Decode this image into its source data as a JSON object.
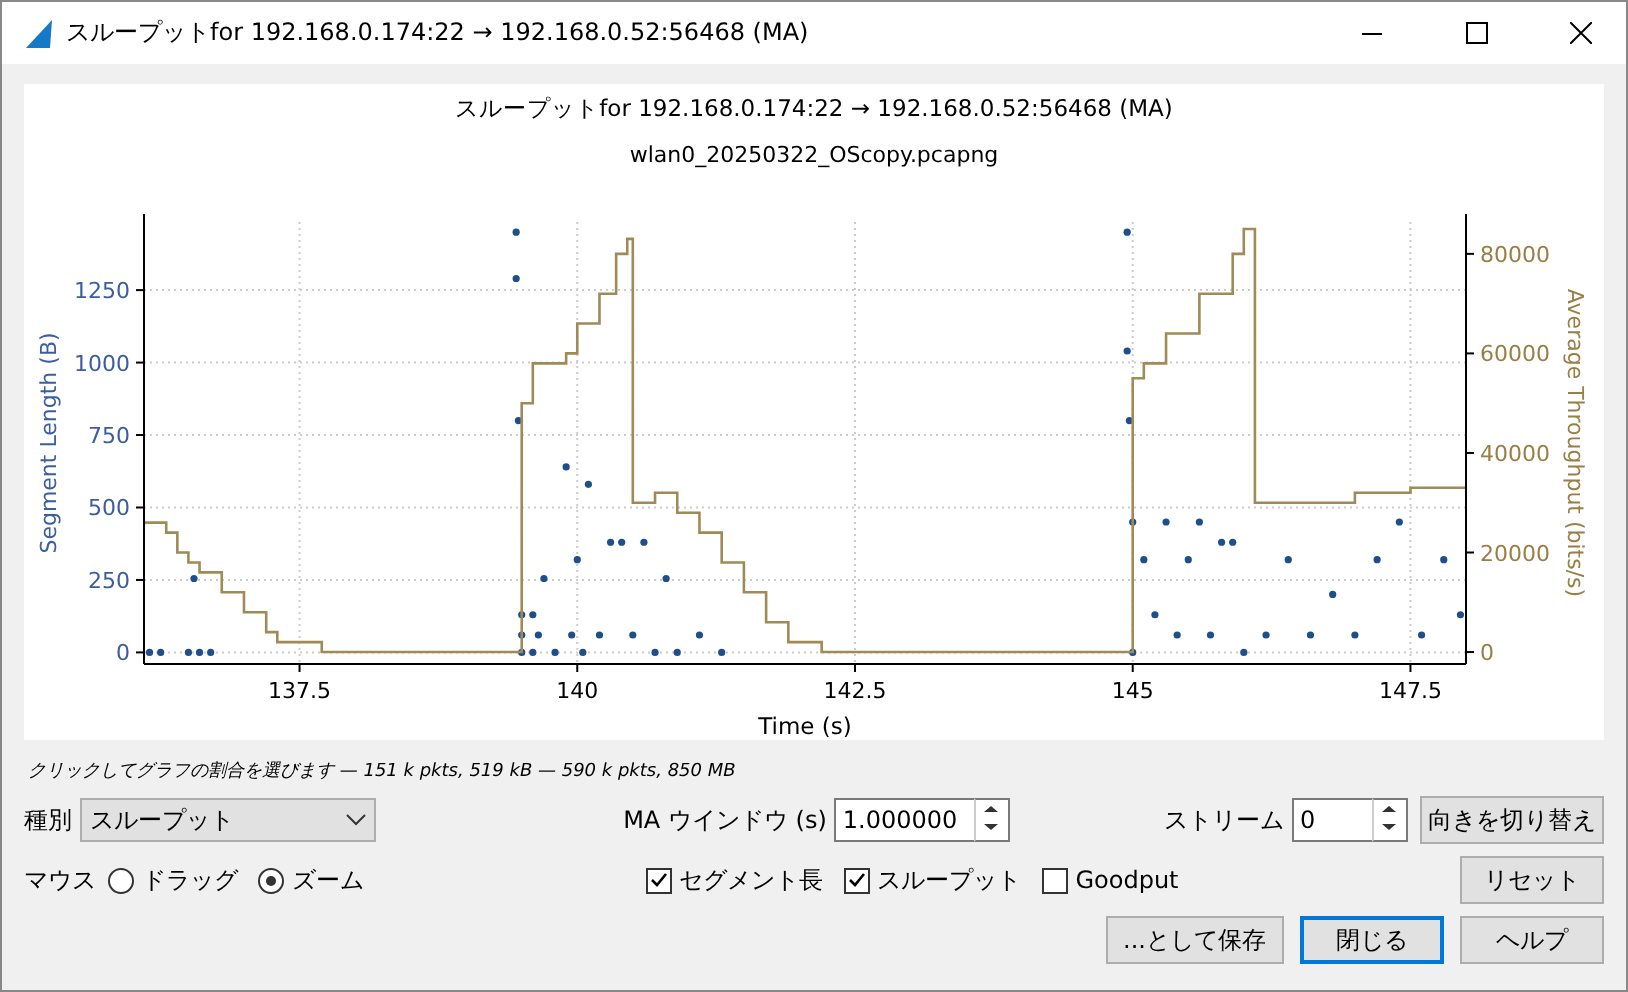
{
  "window": {
    "title": "スループットfor 192.168.0.174:22 → 192.168.0.52:56468 (MA)"
  },
  "chart": {
    "title": "スループットfor 192.168.0.174:22 → 192.168.0.52:56468 (MA)",
    "subtitle": "wlan0_20250322_OScopy.pcapng",
    "chart_data": {
      "type": "line",
      "xlabel": "Time (s)",
      "ylabel": "Segment Length (B)",
      "y2label": "Average Throughput (bits/s)",
      "grid": true,
      "xlim": [
        136.1,
        148
      ],
      "ylim": [
        -40,
        1485
      ],
      "y2lim": [
        -2400,
        86400
      ],
      "xticks": [
        137.5,
        140,
        142.5,
        145,
        147.5
      ],
      "yticks": [
        0,
        250,
        500,
        750,
        1000,
        1250
      ],
      "y2ticks": [
        0,
        20000,
        40000,
        60000,
        80000
      ],
      "series": [
        {
          "type": "scatter",
          "color": "#1f4e8c",
          "x": [
            136.15,
            136.25,
            136.5,
            136.55,
            136.6,
            136.7,
            139.45,
            139.45,
            139.47,
            139.5,
            139.5,
            139.5,
            139.65,
            139.6,
            139.6,
            139.7,
            139.8,
            139.9,
            139.95,
            140,
            140.05,
            140.1,
            140.2,
            140.3,
            140.4,
            140.5,
            140.6,
            140.7,
            140.8,
            140.9,
            141.1,
            141.3,
            144.95,
            144.95,
            144.97,
            145,
            145,
            145.1,
            145.2,
            145.3,
            145.4,
            145.5,
            145.6,
            145.7,
            145.8,
            145.9,
            146,
            146.2,
            146.4,
            146.6,
            146.8,
            147,
            147.2,
            147.4,
            147.6,
            147.8,
            147.95
          ],
          "values": [
            0,
            0,
            0,
            255,
            0,
            0,
            1450,
            1290,
            800,
            130,
            60,
            0,
            60,
            130,
            0,
            255,
            0,
            640,
            60,
            320,
            0,
            580,
            60,
            380,
            380,
            60,
            380,
            0,
            255,
            0,
            60,
            0,
            1450,
            1040,
            800,
            450,
            0,
            320,
            130,
            450,
            60,
            320,
            450,
            60,
            380,
            380,
            0,
            60,
            320,
            60,
            200,
            60,
            320,
            450,
            60,
            320,
            130
          ]
        },
        {
          "type": "line",
          "axis": "y2",
          "color": "#a08a55",
          "x": [
            136.1,
            136.3,
            136.3,
            136.4,
            136.4,
            136.5,
            136.5,
            136.6,
            136.6,
            136.8,
            136.8,
            137,
            137,
            137.2,
            137.2,
            137.3,
            137.3,
            137.7,
            137.7,
            139.4,
            139.5,
            139.5,
            139.6,
            139.6,
            139.9,
            139.9,
            140,
            140,
            140.2,
            140.2,
            140.35,
            140.35,
            140.45,
            140.45,
            140.5,
            140.5,
            140.7,
            140.7,
            140.9,
            140.9,
            141.1,
            141.1,
            141.3,
            141.3,
            141.5,
            141.5,
            141.7,
            141.7,
            141.9,
            141.9,
            142.2,
            142.2,
            144.9,
            145,
            145,
            145.1,
            145.1,
            145.3,
            145.3,
            145.6,
            145.6,
            145.9,
            145.9,
            146,
            146,
            146.1,
            146.1,
            146.5,
            147,
            147,
            147.5,
            147.5,
            148
          ],
          "values": [
            26000,
            26000,
            24000,
            24000,
            20000,
            20000,
            18000,
            18000,
            16000,
            16000,
            12000,
            12000,
            8000,
            8000,
            4000,
            4000,
            2000,
            2000,
            0,
            0,
            0,
            50000,
            50000,
            58000,
            58000,
            60000,
            60000,
            66000,
            66000,
            72000,
            72000,
            80000,
            80000,
            83000,
            83000,
            30000,
            30000,
            32000,
            32000,
            28000,
            28000,
            24000,
            24000,
            18000,
            18000,
            12000,
            12000,
            6000,
            6000,
            2000,
            2000,
            0,
            0,
            0,
            55000,
            55000,
            58000,
            58000,
            64000,
            64000,
            72000,
            72000,
            80000,
            80000,
            85000,
            85000,
            30000,
            30000,
            30000,
            32000,
            32000,
            33000,
            33000
          ]
        }
      ]
    }
  },
  "status_text": "クリックしてグラフの割合を選びます — 151 k pkts, 519 kB — 590 k pkts, 850 MB",
  "type_select": {
    "label": "種別",
    "value": "スループット"
  },
  "ma_window": {
    "label": "MA ウインドウ (s)",
    "value": "1.000000"
  },
  "stream": {
    "label": "ストリーム",
    "value": "0"
  },
  "switch_direction_button": "向きを切り替え",
  "mouse": {
    "label": "マウス",
    "options": [
      {
        "label": "ドラッグ",
        "selected": false
      },
      {
        "label": "ズーム",
        "selected": true
      }
    ]
  },
  "series_toggles": [
    {
      "label": "セグメント長",
      "checked": true
    },
    {
      "label": "スループット",
      "checked": true
    },
    {
      "label": "Goodput",
      "checked": false
    }
  ],
  "reset_button": "リセット",
  "buttons": [
    {
      "label": "...として保存",
      "default": false
    },
    {
      "label": "閉じる",
      "default": true
    },
    {
      "label": "ヘルプ",
      "default": false
    }
  ]
}
